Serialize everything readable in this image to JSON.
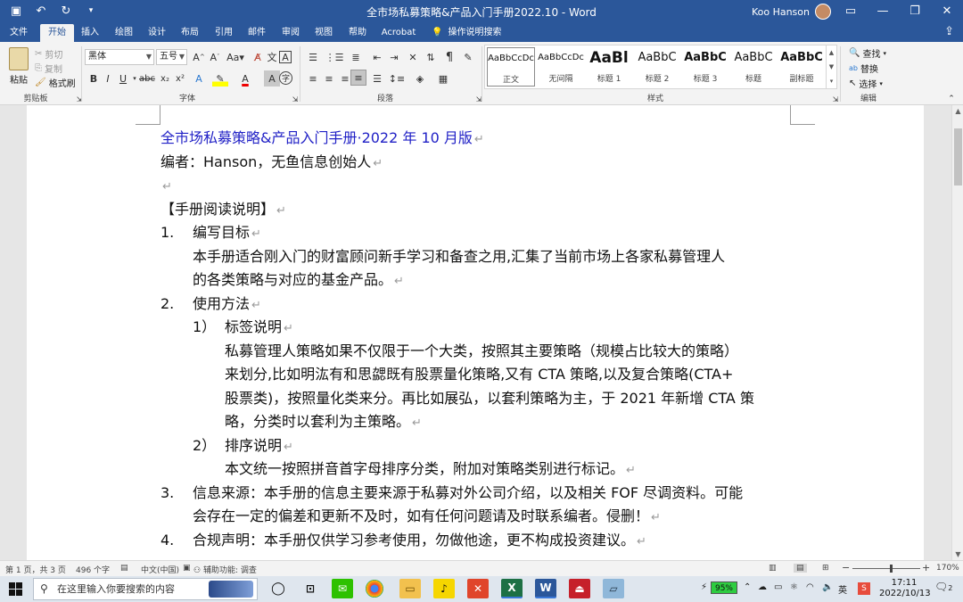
{
  "titlebar": {
    "title": "全市场私募策略&产品入门手册2022.10 - Word",
    "user": "Koo Hanson",
    "qat": [
      "save-icon",
      "undo-icon",
      "redo-icon",
      "customize-icon"
    ]
  },
  "tabs": [
    "文件",
    "开始",
    "插入",
    "绘图",
    "设计",
    "布局",
    "引用",
    "邮件",
    "审阅",
    "视图",
    "帮助",
    "Acrobat"
  ],
  "active_tab": "开始",
  "tellme": "操作说明搜索",
  "ribbon": {
    "clipboard": {
      "label": "剪贴板",
      "paste": "粘贴",
      "cut": "剪切",
      "copy": "复制",
      "format_painter": "格式刷"
    },
    "font": {
      "label": "字体",
      "font_name": "黑体",
      "font_size": "五号"
    },
    "paragraph": {
      "label": "段落"
    },
    "styles": {
      "label": "样式",
      "items": [
        {
          "preview": "AaBbCcDc",
          "name": "正文"
        },
        {
          "preview": "AaBbCcDc",
          "name": "无间隔"
        },
        {
          "preview": "AaBl",
          "name": "标题 1"
        },
        {
          "preview": "AaBbC",
          "name": "标题 2"
        },
        {
          "preview": "AaBbC",
          "name": "标题 3"
        },
        {
          "preview": "AaBbC",
          "name": "标题"
        },
        {
          "preview": "AaBbC",
          "name": "副标题"
        }
      ]
    },
    "editing": {
      "label": "编辑",
      "find": "查找",
      "replace": "替换",
      "select": "选择"
    }
  },
  "document": {
    "title": "全市场私募策略&产品入门手册·2022 年 10 月版",
    "author": "编者：Hanson，无鱼信息创始人",
    "section_heading": "【手册阅读说明】",
    "items": [
      {
        "num": "1.",
        "heading": "编写目标",
        "body": [
          "本手册适合刚入门的财富顾问新手学习和备查之用,汇集了当前市场上各家私募管理人",
          "的各类策略与对应的基金产品。"
        ]
      },
      {
        "num": "2.",
        "heading": "使用方法"
      },
      {
        "num": "3.",
        "body": [
          "信息来源：本手册的信息主要来源于私募对外公司介绍，以及相关 FOF 尽调资料。可能",
          "会存在一定的偏差和更新不及时，如有任何问题请及时联系编者。侵删！"
        ]
      },
      {
        "num": "4.",
        "body": [
          "合规声明：本手册仅供学习参考使用，勿做他途，更不构成投资建议。"
        ]
      }
    ],
    "subitems": [
      {
        "num": "1）",
        "heading": "标签说明",
        "lines": [
          "私募管理人策略如果不仅限于一个大类，按照其主要策略（规模占比较大的策略）",
          "来划分,比如明汯有和思勰既有股票量化策略,又有 CTA 策略,以及复合策略(CTA+",
          "股票类)，按照量化类来分。再比如展弘，以套利策略为主，于 2021 年新增 CTA 策",
          "略，分类时以套利为主策略。"
        ]
      },
      {
        "num": "2）",
        "heading": "排序说明",
        "lines": [
          "本文统一按照拼音首字母排序分类，附加对策略类别进行标记。"
        ]
      }
    ]
  },
  "statusbar": {
    "page": "第 1 页，共 3 页",
    "words": "496 个字",
    "language": "中文(中国)",
    "accessibility": "辅助功能: 调查",
    "zoom": "170%",
    "zoom_plus": "+"
  },
  "taskbar": {
    "search_placeholder": "在这里输入你要搜索的内容",
    "battery": "95%",
    "time": "17:11",
    "date": "2022/10/13",
    "notifications": "2",
    "ime": "英"
  }
}
